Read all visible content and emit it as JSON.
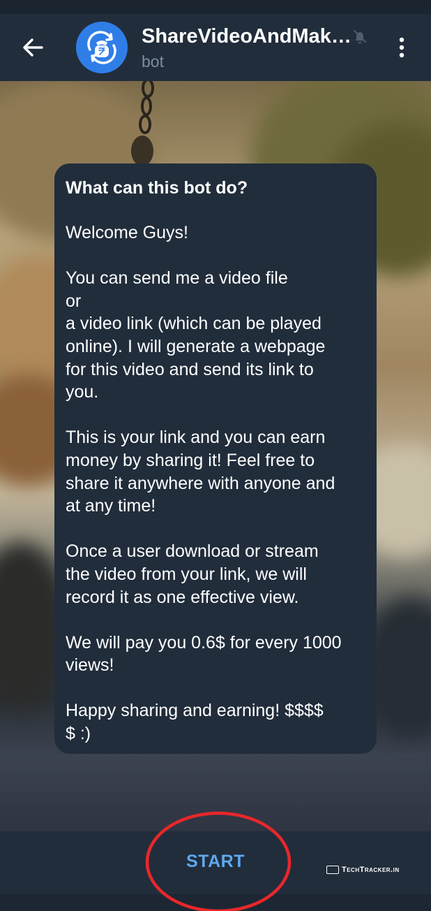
{
  "header": {
    "back_icon": "arrow-left-icon",
    "avatar_icon": "rupee-coin-refresh-icon",
    "title": "ShareVideoAndMak…",
    "mute_icon": "bell-muted-icon",
    "subtitle": "bot",
    "menu_icon": "more-vertical-icon"
  },
  "bubble": {
    "title": "What can this bot do?",
    "paragraphs": [
      "Welcome Guys!",
      "You can send me a video file\nor\na video link (which can be played\nonline). I will generate a webpage\nfor this video and send its link to\nyou.",
      "This is your link and you can earn\nmoney by sharing it! Feel free to\nshare it anywhere with anyone and\nat any time!",
      "Once a user download or stream\nthe video from your link, we will\nrecord it as one effective view.",
      "We will pay you 0.6$ for every 1000\nviews!",
      "Happy sharing and earning! $$$$\n$ :)"
    ]
  },
  "bottom": {
    "start_label": "START"
  },
  "watermark": {
    "text": "TechTracker.in"
  },
  "colors": {
    "header_bg": "#212d3b",
    "accent": "#5ea8ef",
    "avatar_bg": "#2f7ee8",
    "annotation": "#e8272b"
  }
}
